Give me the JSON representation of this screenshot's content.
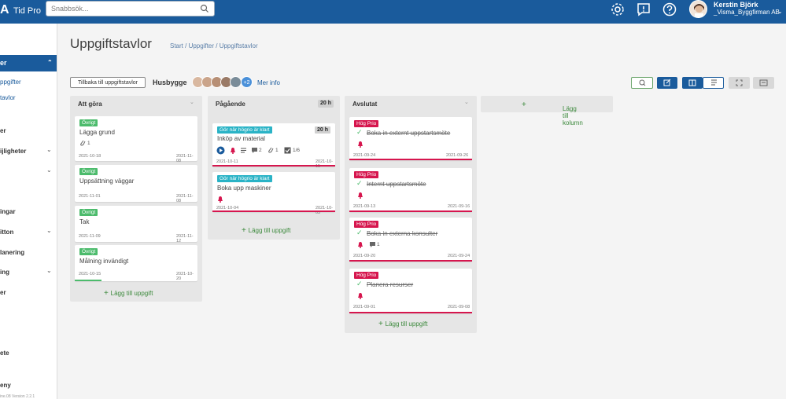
{
  "app": {
    "logo": "A",
    "product": "Tid Pro"
  },
  "search": {
    "placeholder": "Snabbsök..."
  },
  "user": {
    "name": "Kerstin Björk",
    "company": "_Visma_Byggfirman AB"
  },
  "sidebar": {
    "active": "er",
    "sub_items": [
      "ppgifter",
      "tavlor"
    ],
    "items": [
      "er",
      "ijligheter",
      "ingar",
      "itton",
      "lanering",
      "ing",
      "er",
      "ete",
      "eny"
    ],
    "footer": "ine.08 Version 2.2.1"
  },
  "page": {
    "title": "Uppgiftstavlor",
    "breadcrumb": "Start / Uppgifter / Uppgiftstavlor"
  },
  "toolbar": {
    "back_label": "Tillbaka till uppgiftstavlor",
    "board_name": "Husbygge",
    "more_members": "+2",
    "more_info": "Mer info"
  },
  "columns": [
    {
      "name": "Att göra",
      "add_label": "Lägg till uppgift",
      "cards": [
        {
          "tag": "Övrigt",
          "title": "Lägga grund",
          "attachments": "1",
          "start": "2021-10-18",
          "end": "2021-11-08"
        },
        {
          "tag": "Övrigt",
          "title": "Uppsättning väggar",
          "start": "2021-11-01",
          "end": "2021-11-08"
        },
        {
          "tag": "Övrigt",
          "title": "Tak",
          "start": "2021-11-09",
          "end": "2021-11-12"
        },
        {
          "tag": "Övrigt",
          "title": "Målning invändigt",
          "start": "2021-10-15",
          "end": "2021-10-20"
        }
      ]
    },
    {
      "name": "Pågående",
      "hours": "20 h",
      "add_label": "Lägg till uppgift",
      "cards": [
        {
          "tag": "Gör när högrio är klart",
          "title": "Inköp av material",
          "hours": "20 h",
          "comments": "2",
          "attachments": "1",
          "checklist": "1/6",
          "start": "2021-10-11",
          "end": "2021-10-15"
        },
        {
          "tag": "Gör när högrio är klart",
          "title": "Boka upp maskiner",
          "start": "2021-10-04",
          "end": "2021-10-03"
        }
      ]
    },
    {
      "name": "Avslutat",
      "add_label": "Lägg till uppgift",
      "cards": [
        {
          "tag": "Hög Prio",
          "title": "Boka in externt uppstartsmöte",
          "start": "2021-09-24",
          "end": "2021-09-26"
        },
        {
          "tag": "Hög Prio",
          "title": "Internt uppstartsmöte",
          "start": "2021-09-13",
          "end": "2021-09-16"
        },
        {
          "tag": "Hög Prio",
          "title": "Boka in externa konsulter",
          "comments": "1",
          "start": "2021-09-20",
          "end": "2021-09-24"
        },
        {
          "tag": "Hög Prio",
          "title": "Planera resurser",
          "start": "2021-09-01",
          "end": "2021-09-08"
        }
      ]
    }
  ],
  "add_column": "Lägg till kolumn",
  "colors": {
    "brand": "#1a5b9c",
    "green": "#4cbb6c",
    "teal": "#2ab3c6",
    "red": "#d6164e"
  }
}
